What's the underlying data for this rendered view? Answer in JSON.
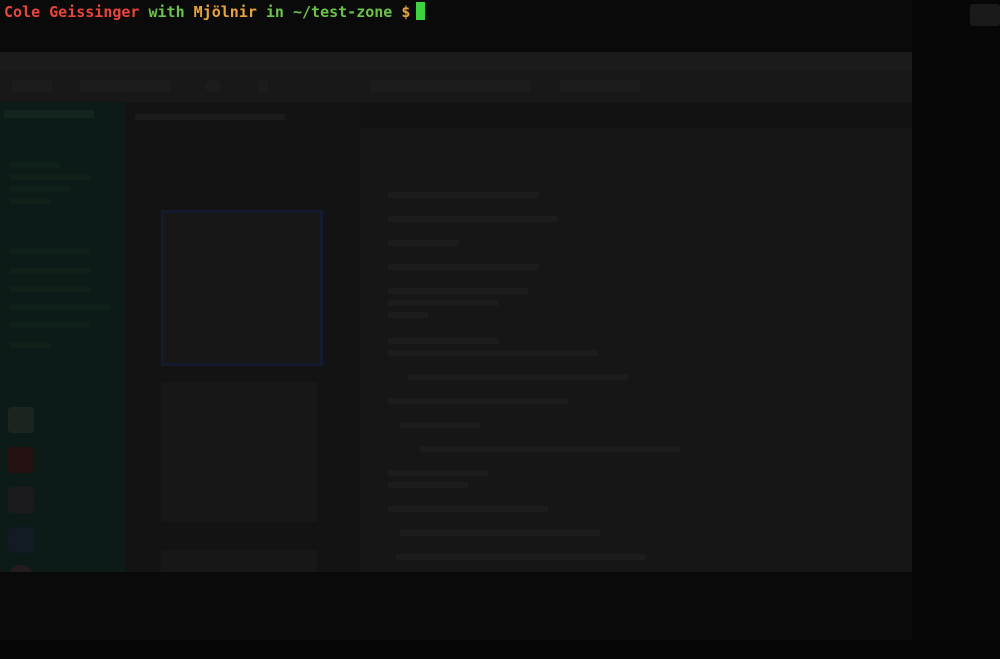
{
  "terminal": {
    "user": "Cole Geissinger",
    "kw_with": "with",
    "host": "Mjölnir",
    "kw_in": "in",
    "path": "~/test-zone",
    "symbol": "$"
  },
  "colors": {
    "user": "#e8453c",
    "keyword": "#6cc24a",
    "host": "#e8a33c",
    "cursor": "#3fd13f"
  }
}
